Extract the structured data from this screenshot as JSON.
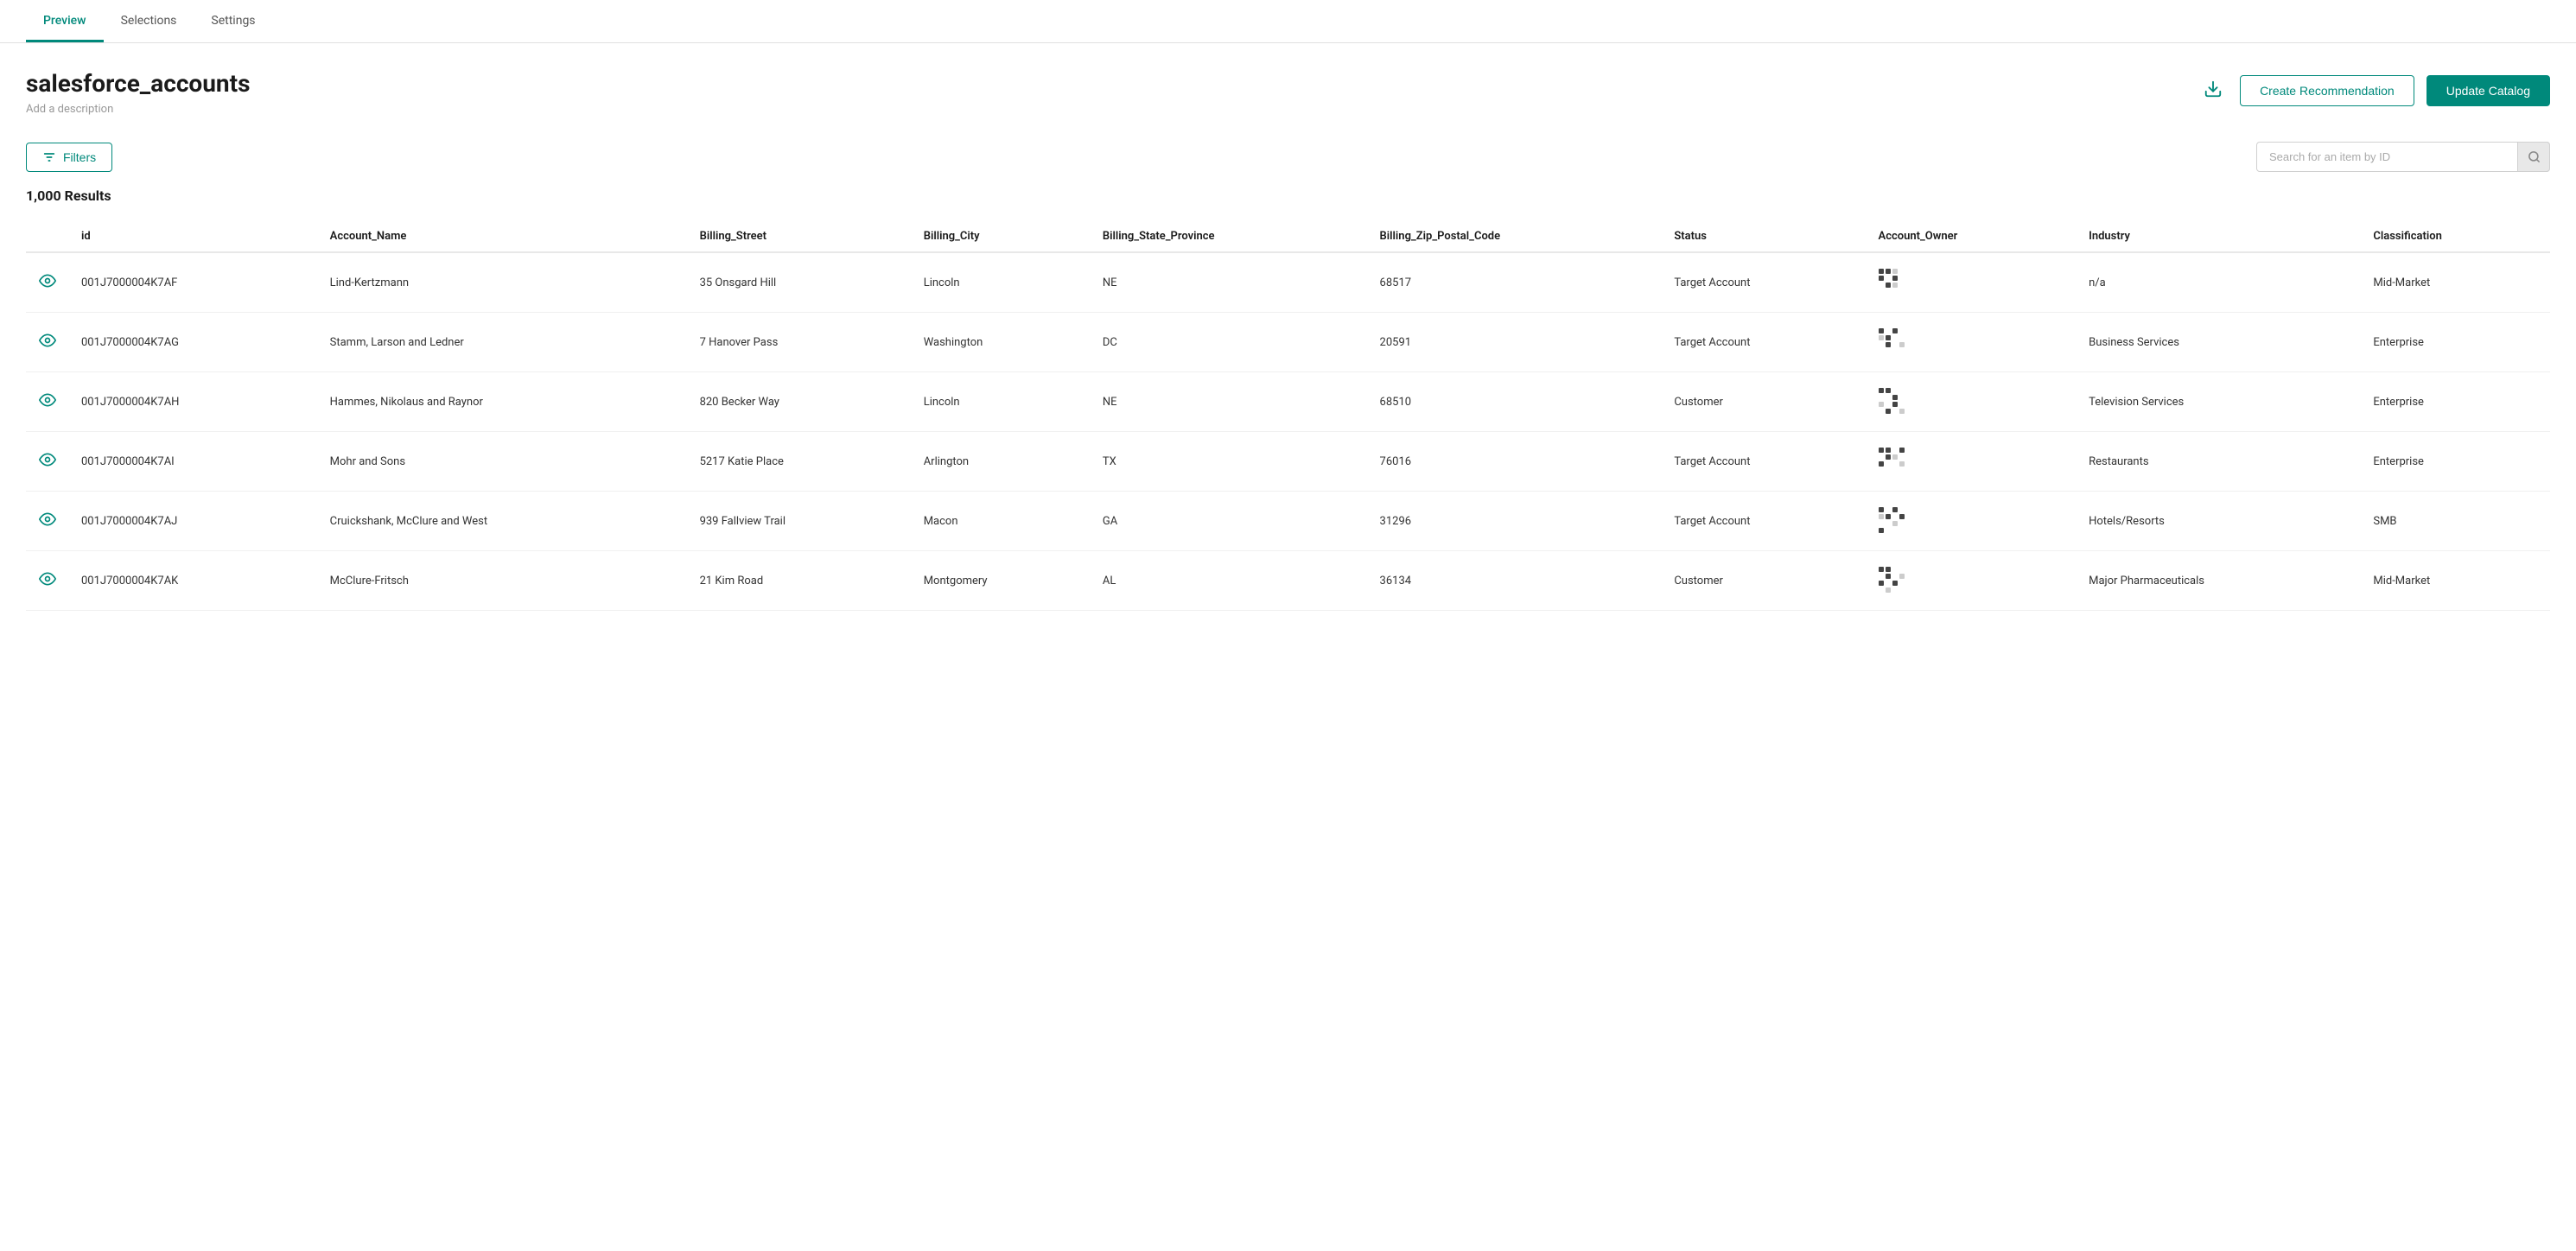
{
  "nav": {
    "tabs": [
      {
        "id": "preview",
        "label": "Preview",
        "active": true
      },
      {
        "id": "selections",
        "label": "Selections",
        "active": false
      },
      {
        "id": "settings",
        "label": "Settings",
        "active": false
      }
    ]
  },
  "header": {
    "title": "salesforce_accounts",
    "description": "Add a description",
    "download_tooltip": "Download",
    "create_recommendation_label": "Create Recommendation",
    "update_catalog_label": "Update Catalog"
  },
  "toolbar": {
    "filters_label": "Filters",
    "search_placeholder": "Search for an item by ID"
  },
  "results": {
    "count_label": "1,000 Results"
  },
  "table": {
    "columns": [
      "",
      "id",
      "Account_Name",
      "Billing_Street",
      "Billing_City",
      "Billing_State_Province",
      "Billing_Zip_Postal_Code",
      "Status",
      "Account_Owner",
      "Industry",
      "Classification"
    ],
    "rows": [
      {
        "id": "001J7000004K7AF",
        "account_name": "Lind-Kertzmann",
        "billing_street": "35 Onsgard Hill",
        "billing_city": "Lincoln",
        "billing_state": "NE",
        "billing_zip": "68517",
        "status": "Target Account",
        "industry": "n/a",
        "classification": "Mid-Market",
        "avatar_pixels": [
          "dark",
          "dark",
          "light",
          "empty",
          "dark",
          "empty",
          "dark",
          "empty",
          "empty",
          "dark",
          "light",
          "empty",
          "empty",
          "empty",
          "empty",
          "empty"
        ]
      },
      {
        "id": "001J7000004K7AG",
        "account_name": "Stamm, Larson and Ledner",
        "billing_street": "7 Hanover Pass",
        "billing_city": "Washington",
        "billing_state": "DC",
        "billing_zip": "20591",
        "status": "Target Account",
        "industry": "Business Services",
        "classification": "Enterprise",
        "avatar_pixels": [
          "dark",
          "empty",
          "dark",
          "empty",
          "light",
          "dark",
          "empty",
          "empty",
          "empty",
          "dark",
          "empty",
          "light",
          "empty",
          "empty",
          "empty",
          "empty"
        ]
      },
      {
        "id": "001J7000004K7AH",
        "account_name": "Hammes, Nikolaus and Raynor",
        "billing_street": "820 Becker Way",
        "billing_city": "Lincoln",
        "billing_state": "NE",
        "billing_zip": "68510",
        "status": "Customer",
        "industry": "Television Services",
        "classification": "Enterprise",
        "avatar_pixels": [
          "dark",
          "dark",
          "empty",
          "empty",
          "empty",
          "empty",
          "dark",
          "empty",
          "light",
          "empty",
          "dark",
          "empty",
          "empty",
          "dark",
          "empty",
          "light"
        ]
      },
      {
        "id": "001J7000004K7AI",
        "account_name": "Mohr and Sons",
        "billing_street": "5217 Katie Place",
        "billing_city": "Arlington",
        "billing_state": "TX",
        "billing_zip": "76016",
        "status": "Target Account",
        "industry": "Restaurants",
        "classification": "Enterprise",
        "avatar_pixels": [
          "dark",
          "dark",
          "empty",
          "dark",
          "empty",
          "dark",
          "light",
          "empty",
          "dark",
          "empty",
          "empty",
          "light",
          "empty",
          "empty",
          "empty",
          "empty"
        ]
      },
      {
        "id": "001J7000004K7AJ",
        "account_name": "Cruickshank, McClure and West",
        "billing_street": "939 Fallview Trail",
        "billing_city": "Macon",
        "billing_state": "GA",
        "billing_zip": "31296",
        "status": "Target Account",
        "industry": "Hotels/Resorts",
        "classification": "SMB",
        "avatar_pixels": [
          "dark",
          "empty",
          "dark",
          "empty",
          "light",
          "dark",
          "empty",
          "dark",
          "empty",
          "empty",
          "light",
          "empty",
          "dark",
          "empty",
          "empty",
          "empty"
        ]
      },
      {
        "id": "001J7000004K7AK",
        "account_name": "McClure-Fritsch",
        "billing_street": "21 Kim Road",
        "billing_city": "Montgomery",
        "billing_state": "AL",
        "billing_zip": "36134",
        "status": "Customer",
        "industry": "Major Pharmaceuticals",
        "classification": "Mid-Market",
        "avatar_pixels": [
          "dark",
          "dark",
          "empty",
          "empty",
          "empty",
          "dark",
          "empty",
          "light",
          "dark",
          "empty",
          "dark",
          "empty",
          "empty",
          "light",
          "empty",
          "empty"
        ]
      }
    ]
  }
}
